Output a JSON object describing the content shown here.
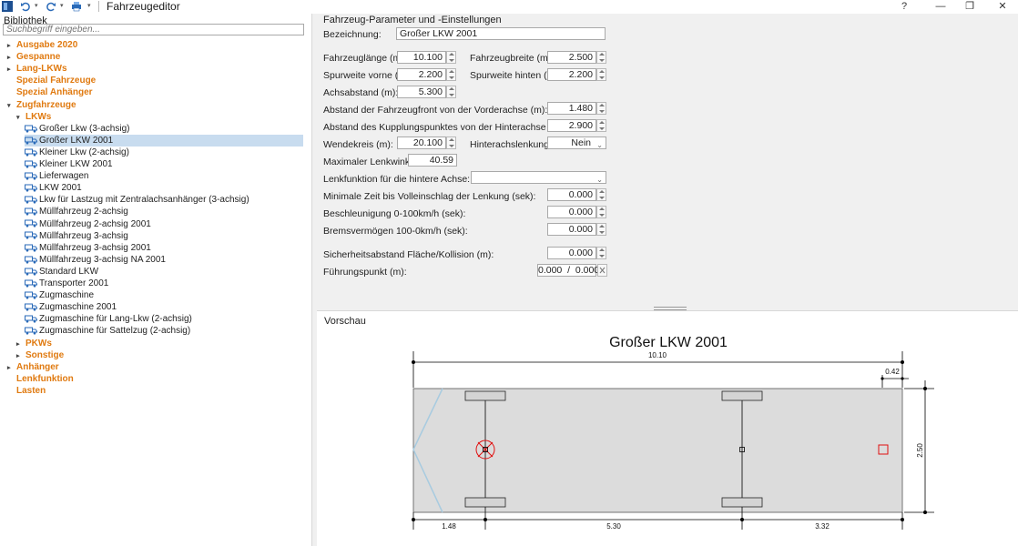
{
  "window": {
    "title": "Fahrzeugeditor",
    "help": "?",
    "minimize": "—",
    "maximize": "❐",
    "close": "✕"
  },
  "library": {
    "label": "Bibliothek",
    "search_placeholder": "Suchbegriff eingeben...",
    "tree": [
      {
        "label": "Ausgabe 2020",
        "kind": "cat",
        "expander": "▸"
      },
      {
        "label": "Gespanne",
        "kind": "cat",
        "expander": "▸"
      },
      {
        "label": "Lang-LKWs",
        "kind": "cat",
        "expander": "▸"
      },
      {
        "label": "Spezial Fahrzeuge",
        "kind": "cat",
        "expander": ""
      },
      {
        "label": "Spezial Anhänger",
        "kind": "cat",
        "expander": ""
      },
      {
        "label": "Zugfahrzeuge",
        "kind": "cat",
        "expander": "▾"
      },
      {
        "label": "LKWs",
        "kind": "cat",
        "expander": "▾"
      },
      {
        "label": "Großer Lkw (3-achsig)",
        "kind": "item"
      },
      {
        "label": "Großer LKW 2001",
        "kind": "item",
        "selected": true
      },
      {
        "label": "Kleiner Lkw (2-achsig)",
        "kind": "item"
      },
      {
        "label": "Kleiner LKW 2001",
        "kind": "item"
      },
      {
        "label": "Lieferwagen",
        "kind": "item"
      },
      {
        "label": "LKW 2001",
        "kind": "item"
      },
      {
        "label": "Lkw für Lastzug mit Zentralachsanhänger (3-achsig)",
        "kind": "item"
      },
      {
        "label": "Müllfahrzeug 2-achsig",
        "kind": "item"
      },
      {
        "label": "Müllfahrzeug 2-achsig 2001",
        "kind": "item"
      },
      {
        "label": "Müllfahrzeug 3-achsig",
        "kind": "item"
      },
      {
        "label": "Müllfahrzeug 3-achsig 2001",
        "kind": "item"
      },
      {
        "label": "Müllfahrzeug 3-achsig NA 2001",
        "kind": "item"
      },
      {
        "label": "Standard LKW",
        "kind": "item"
      },
      {
        "label": "Transporter 2001",
        "kind": "item"
      },
      {
        "label": "Zugmaschine",
        "kind": "item"
      },
      {
        "label": "Zugmaschine 2001",
        "kind": "item"
      },
      {
        "label": "Zugmaschine für Lang-Lkw (2-achsig)",
        "kind": "item"
      },
      {
        "label": "Zugmaschine für Sattelzug (2-achsig)",
        "kind": "item"
      },
      {
        "label": "PKWs",
        "kind": "cat",
        "expander": "▸"
      },
      {
        "label": "Sonstige",
        "kind": "cat",
        "expander": "▸"
      },
      {
        "label": "Anhänger",
        "kind": "cat",
        "expander": "▸"
      },
      {
        "label": "Lenkfunktion",
        "kind": "cat",
        "expander": ""
      },
      {
        "label": "Lasten",
        "kind": "cat",
        "expander": ""
      }
    ]
  },
  "params": {
    "section_title": "Fahrzeug-Parameter und -Einstellungen",
    "bezeichnung_label": "Bezeichnung:",
    "bezeichnung_value": "Großer LKW 2001",
    "laenge_label": "Fahrzeuglänge (m):",
    "laenge_value": "10.100",
    "breite_label": "Fahrzeugbreite (m):",
    "breite_value": "2.500",
    "spur_vorne_label": "Spurweite vorne (m):",
    "spur_vorne_value": "2.200",
    "spur_hinten_label": "Spurweite hinten (m):",
    "spur_hinten_value": "2.200",
    "achsabstand_label": "Achsabstand (m):",
    "achsabstand_value": "5.300",
    "abstand_front_label": "Abstand der Fahrzeugfront von der Vorderachse (m):",
    "abstand_front_value": "1.480",
    "abstand_kupplung_label": "Abstand des Kupplungspunktes von der Hinterachse (m):",
    "abstand_kupplung_value": "2.900",
    "wendekreis_label": "Wendekreis (m):",
    "wendekreis_value": "20.100",
    "hinterachslenkung_label": "Hinterachslenkung:",
    "hinterachslenkung_value": "Nein",
    "lenkwinkel_label": "Maximaler Lenkwinkel (°):",
    "lenkwinkel_value": "40.59",
    "lenkfunktion_label": "Lenkfunktion für die hintere Achse:",
    "lenkfunktion_value": "",
    "min_zeit_label": "Minimale Zeit bis Volleinschlag der Lenkung (sek):",
    "min_zeit_value": "0.000",
    "beschleunigung_label": "Beschleunigung 0-100km/h (sek):",
    "beschleunigung_value": "0.000",
    "bremsen_label": "Bremsvermögen 100-0km/h (sek):",
    "bremsen_value": "0.000",
    "sicherheit_label": "Sicherheitsabstand Fläche/Kollision (m):",
    "sicherheit_value": "0.000",
    "fuehrung_label": "Führungspunkt (m):",
    "fuehrung_value": "0.000  /  0.000"
  },
  "preview": {
    "label": "Vorschau",
    "title": "Großer LKW 2001",
    "dim_length": "10.10",
    "dim_rear_overhang": "0.42",
    "dim_width": "2.50",
    "dim_front": "1.48",
    "dim_wheelbase": "5.30",
    "dim_rear": "3.32"
  },
  "colors": {
    "category": "#e07a10",
    "selection": "#c8dcef",
    "vehicle_icon": "#2a6ab8",
    "truck_body": "#dcdcdc",
    "marker_red": "#e01010",
    "front_line": "#a8cbe0"
  }
}
